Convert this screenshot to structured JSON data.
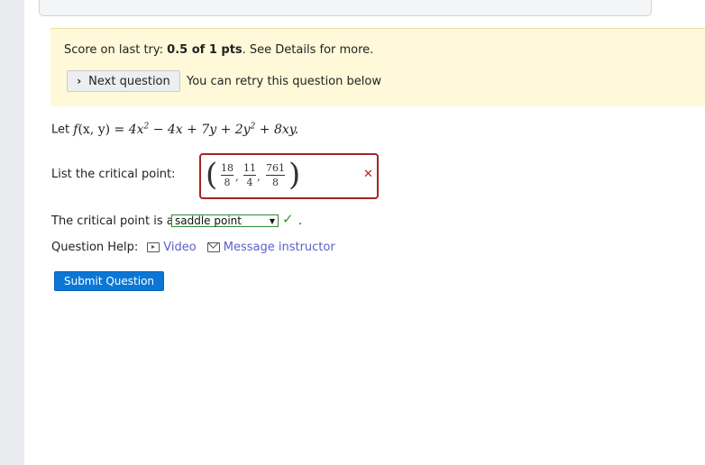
{
  "alert": {
    "score_prefix": "Score on last try: ",
    "score_value": "0.5 of 1 pts",
    "score_suffix": ". See Details for more.",
    "next_button": "Next question",
    "retry_text": "You can retry this question below"
  },
  "problem": {
    "let": "Let",
    "func": "f",
    "args": "(x, y)",
    "equals": " = ",
    "rhs_parts": [
      "4x",
      "2",
      " − 4x + 7y + 2y",
      "2",
      " + 8xy."
    ]
  },
  "answer": {
    "label": "List the critical point:",
    "fractions": [
      {
        "num": "18",
        "den": "8"
      },
      {
        "num": "11",
        "den": "4"
      },
      {
        "num": "761",
        "den": "8"
      }
    ],
    "status_icon": "x-mark-icon",
    "status_color": "#c21d1d"
  },
  "classification": {
    "label": "The critical point is a",
    "selected": "saddle point",
    "status_icon": "check-icon",
    "status_color": "#2f9a2f",
    "period": "."
  },
  "help": {
    "label": "Question Help:",
    "video": "Video",
    "message": "Message instructor"
  },
  "submit_button": "Submit Question",
  "colors": {
    "accent": "#0b76d6",
    "alert_bg": "#fff9d9",
    "link": "#5b5fc7"
  }
}
